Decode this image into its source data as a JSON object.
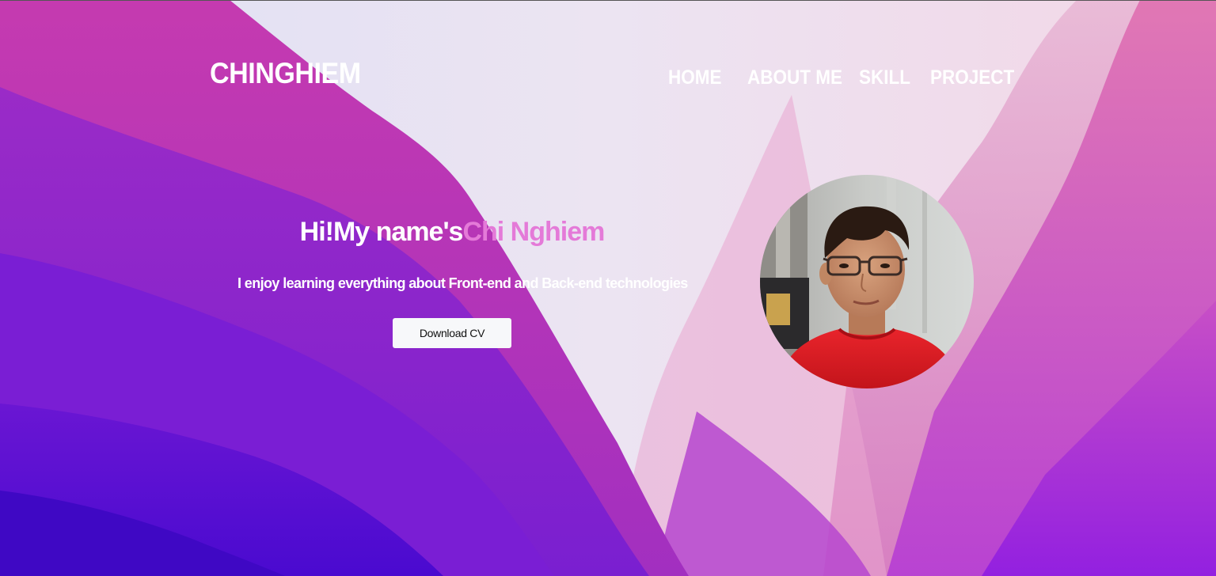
{
  "header": {
    "logo": "CHINGHIEM",
    "nav": [
      {
        "label": "HOME"
      },
      {
        "label": "ABOUT ME"
      },
      {
        "label": "SKILL"
      },
      {
        "label": "PROJECT"
      }
    ]
  },
  "hero": {
    "greeting": "Hi!My name's",
    "name": "Chi Nghiem",
    "tagline": "I enjoy learning everything about Front-end and Back-end technologies",
    "cta_label": "Download CV"
  },
  "icons": {
    "avatar": "profile-photo"
  },
  "colors": {
    "name_accent": "#e47ad8",
    "button_bg": "#f7f8fa",
    "text": "#ffffff"
  }
}
